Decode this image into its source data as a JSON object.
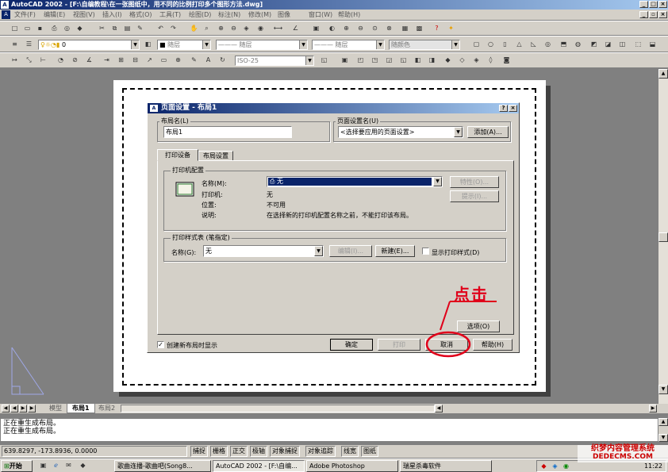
{
  "window": {
    "title": "AutoCAD 2002 - [F:\\自编教程\\在一张图纸中，用不同的比例打印多个图形方法.dwg]",
    "min": "_",
    "max": "□",
    "close": "×"
  },
  "menu": [
    "文件(F)",
    "编辑(E)",
    "视图(V)",
    "插入(I)",
    "格式(O)",
    "工具(T)",
    "绘图(D)",
    "标注(N)",
    "修改(M)",
    "图像",
    "窗口(W)",
    "帮助(H)"
  ],
  "toolbar": {
    "layer_value": "0",
    "color_value": "随层",
    "linetype_value": "随层",
    "lineweight_value": "随层",
    "plotstyle_value": "随颜色",
    "dimstyle_value": "ISO-25"
  },
  "layout_tabs": [
    "模型",
    "布局1",
    "布局2"
  ],
  "dialog": {
    "title": "页面设置 - 布局1",
    "help_btn": "?",
    "close_btn": "×",
    "layout_name_label": "布局名(L)",
    "layout_name_value": "布局1",
    "page_setup_label": "页面设置名(U)",
    "page_setup_value": "<选择要应用的页面设置>",
    "add_button": "添加(A)...",
    "tabs": [
      "打印设备",
      "布局设置"
    ],
    "printer_group": "打印机配置",
    "name_label": "名称(M):",
    "name_value": "无",
    "properties_button": "特性(O)...",
    "hints_button": "提示(I)...",
    "plotter_label": "打印机:",
    "plotter_value": "无",
    "where_label": "位置:",
    "where_value": "不可用",
    "desc_label": "说明:",
    "desc_value": "在选择新的打印机配置名称之前，不能打印该布局。",
    "plotstyle_group": "打印样式表 (笔指定)",
    "ps_name_label": "名称(G):",
    "ps_name_value": "无",
    "edit_button": "编辑(I)...",
    "new_button": "新建(E)...",
    "display_ps_label": "显示打印样式(D)",
    "options_button": "选项(O)",
    "create_on_new_label": "创建新布局时显示",
    "ok_button": "确定",
    "print_button": "打印",
    "cancel_button": "取消",
    "help_button": "帮助(H)"
  },
  "annotation": "点击",
  "command_lines": [
    "正在重生成布局。",
    "正在重生成布局。"
  ],
  "status": {
    "coords": "639.8297, -173.8936, 0.0000",
    "toggles": [
      "捕捉",
      "栅格",
      "正交",
      "极轴",
      "对象捕捉",
      "对象追踪",
      "线宽",
      "图纸"
    ]
  },
  "taskbar": {
    "start": "开始",
    "tasks": [
      "歌曲连播-歌曲吧(Song8...",
      "AutoCAD 2002 - [F:\\自编...",
      "Adobe Photoshop",
      "瑞星杀毒软件"
    ],
    "clock": "11:22"
  },
  "watermark": {
    "line1": "织梦内容管理系统",
    "line2": "DEDECMS.COM"
  },
  "colors": {
    "title_start": "#0a246a",
    "title_end": "#a6caf0",
    "face": "#d4d0c8",
    "annotation": "#e0001a"
  }
}
